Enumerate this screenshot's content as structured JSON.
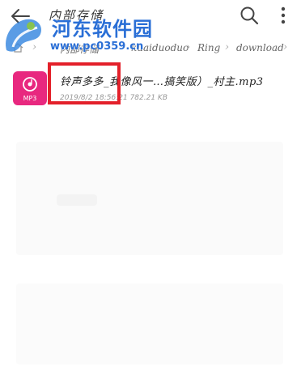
{
  "header": {
    "title": "内部存储",
    "back_icon": "arrow-left-icon",
    "search_icon": "search-icon",
    "more_icon": "more-vertical-icon"
  },
  "watermark": {
    "title": "河东软件园",
    "url": "www.pc0359.cn"
  },
  "breadcrumb": {
    "items": [
      "内部存储",
      "kuaiduoduo",
      "Ring",
      "download"
    ]
  },
  "file": {
    "name": "铃声多多_我像风一…搞笑版）_村主.mp3",
    "meta": "2019/8/2 18:56:21  782.21 KB",
    "type_label": "MP3",
    "icon_color": "#e8287f"
  },
  "highlight_color": "#e3202a"
}
